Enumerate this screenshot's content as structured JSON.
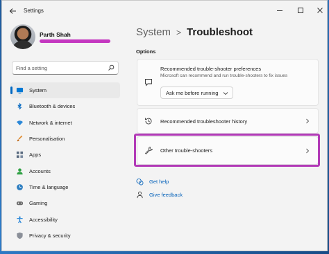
{
  "app": {
    "title": "Settings"
  },
  "profile": {
    "name": "Parth Shah"
  },
  "search": {
    "placeholder": "Find a setting"
  },
  "sidebar": {
    "items": [
      {
        "label": "System",
        "icon": "monitor-icon",
        "active": true
      },
      {
        "label": "Bluetooth & devices",
        "icon": "bluetooth-icon"
      },
      {
        "label": "Network & internet",
        "icon": "wifi-icon"
      },
      {
        "label": "Personalisation",
        "icon": "brush-icon"
      },
      {
        "label": "Apps",
        "icon": "apps-icon"
      },
      {
        "label": "Accounts",
        "icon": "person-icon"
      },
      {
        "label": "Time & language",
        "icon": "globe-clock-icon"
      },
      {
        "label": "Gaming",
        "icon": "gamepad-icon"
      },
      {
        "label": "Accessibility",
        "icon": "accessibility-icon"
      },
      {
        "label": "Privacy & security",
        "icon": "shield-icon"
      }
    ]
  },
  "breadcrumb": {
    "parent": "System",
    "separator": ">",
    "current": "Troubleshoot"
  },
  "options": {
    "section_label": "Options",
    "recommended_prefs": {
      "title": "Recommended trouble-shooter preferences",
      "description": "Microsoft can recommend and run trouble-shooters to fix issues",
      "dropdown_value": "Ask me before running"
    },
    "history": {
      "title": "Recommended troubleshooter history"
    },
    "other": {
      "title": "Other trouble-shooters"
    }
  },
  "links": {
    "help": "Get help",
    "feedback": "Give feedback"
  },
  "colors": {
    "accent": "#0067c0",
    "highlight": "#b23ab7",
    "link": "#005fb8"
  }
}
